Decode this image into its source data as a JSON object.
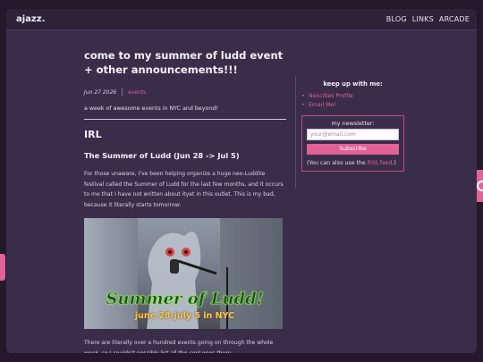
{
  "header": {
    "brand": "ajazz.",
    "nav": [
      "BLOG",
      "LINKS",
      "ARCADE"
    ]
  },
  "post": {
    "title": "come to my summer of ludd event + other announcements!!!",
    "date": "Jun 27 2026",
    "tag": "events",
    "summary": "a week of awesome events in NYC and beyond!",
    "section_heading": "IRL",
    "subheading": "The Summer of Ludd (Jun 28 -> Jul 5)",
    "paragraph1": "For those unaware, I've been helping organize a huge neo-Luddite festival called the Summer of Ludd for the last few months, and it occurs to me that I have not written about ityet in this outlet. This is my bad, because it literally starts tomorrow:",
    "image": {
      "poster_title": "Summer of Ludd!",
      "poster_dates": "june 28-july 5 in NYC"
    },
    "paragraph2": "There are literally over a hundred events going on through the whole week, so I couldn't possibly list all the cool ones there"
  },
  "sidebar": {
    "keep_up_title": "keep up with me:",
    "links": [
      "Neocities Profile",
      "Email Me!"
    ],
    "newsletter": {
      "title": "my newsletter:",
      "email_placeholder": "your@email.com",
      "subscribe_label": "Subscribe",
      "rss_prefix": "(You can also use the ",
      "rss_link": "RSS feed",
      "rss_suffix": ".)"
    }
  },
  "colors": {
    "accent": "#e0609a",
    "background": "#3a2d4a",
    "header": "#2d2339"
  }
}
